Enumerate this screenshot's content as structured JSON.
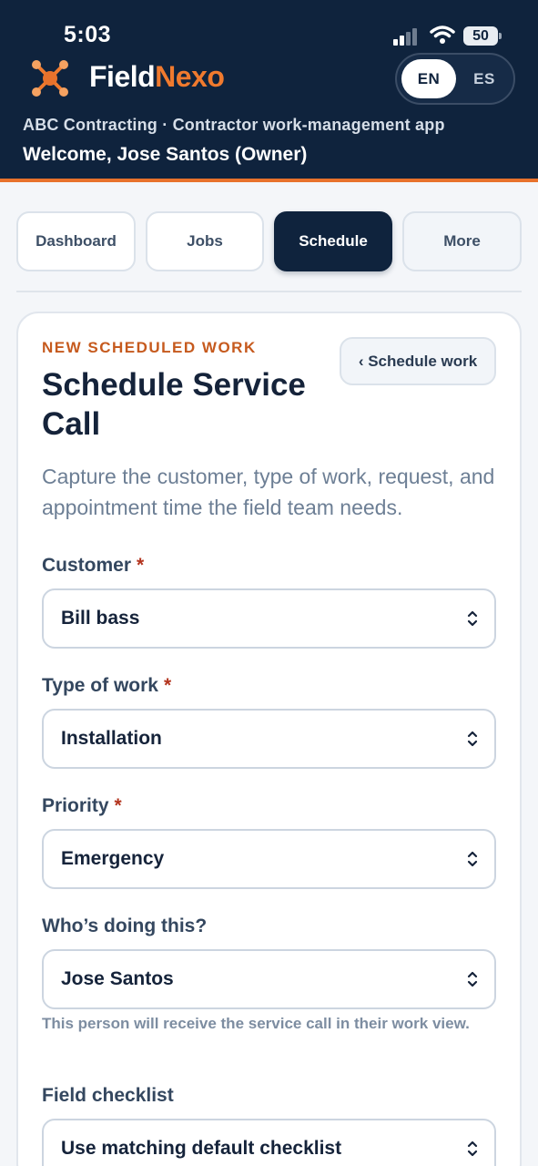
{
  "status_bar": {
    "time": "5:03",
    "battery": "50",
    "icons": [
      "cellular-signal-icon",
      "wifi-icon",
      "battery-icon"
    ]
  },
  "brand": {
    "name_part1": "Field",
    "name_part2": "Nexo",
    "logo_icon": "network-hub-icon",
    "colors": {
      "header_bg": "#0f233d",
      "accent": "#f07a2e"
    }
  },
  "language": {
    "options": [
      "EN",
      "ES"
    ],
    "selected": "EN"
  },
  "header": {
    "company": "ABC Contracting · Contractor work-management app",
    "welcome": "Welcome, Jose Santos (Owner)"
  },
  "tabs": [
    {
      "label": "Dashboard",
      "active": false
    },
    {
      "label": "Jobs",
      "active": false
    },
    {
      "label": "Schedule",
      "active": true
    },
    {
      "label": "More",
      "active": false
    }
  ],
  "form": {
    "eyebrow": "NEW SCHEDULED WORK",
    "title": "Schedule Service Call",
    "back_button": "‹ Schedule work",
    "description": "Capture the customer, type of work, request, and appointment time the field team needs.",
    "required_marker": "*",
    "fields": [
      {
        "label": "Customer",
        "required": true,
        "value": "Bill bass"
      },
      {
        "label": "Type of work",
        "required": true,
        "value": "Installation"
      },
      {
        "label": "Priority",
        "required": true,
        "value": "Emergency"
      },
      {
        "label": "Who’s doing this?",
        "required": false,
        "value": "Jose Santos",
        "hint": "This person will receive the service call in their work view."
      },
      {
        "label": "Field checklist",
        "required": false,
        "value": "Use matching default checklist"
      }
    ]
  }
}
